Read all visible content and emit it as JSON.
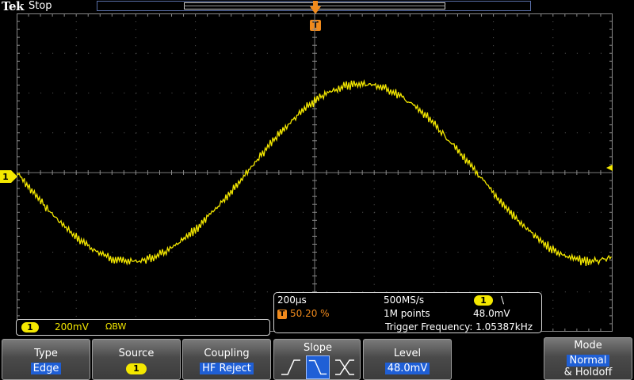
{
  "header": {
    "brand": "Tek",
    "status": "Stop"
  },
  "colors": {
    "trace": "#f4e800",
    "trigger_marker": "#f08a1c",
    "grid": "#5a5a5a",
    "selected": "#1f5fd6"
  },
  "trigger_marker_label": "T",
  "channel_marker_label": "1",
  "channel_info": {
    "channel": "1",
    "scale": "200mV",
    "bw_symbol": "ΩBW"
  },
  "readout": {
    "timebase": "200µs",
    "trigger_position": "50.20 %",
    "sample_rate": "500MS/s",
    "record_length": "1M points",
    "trigger_channel": "1",
    "trigger_slope_symbol": "\\",
    "trigger_level": "48.0mV",
    "trigger_frequency": "Trigger Frequency: 1.05387kHz"
  },
  "menu": {
    "type": {
      "title": "Type",
      "value": "Edge"
    },
    "source": {
      "title": "Source",
      "value": "1"
    },
    "coupling": {
      "title": "Coupling",
      "value": "HF Reject"
    },
    "slope": {
      "title": "Slope",
      "selected": "falling",
      "options": [
        "rising",
        "falling",
        "either"
      ]
    },
    "level": {
      "title": "Level",
      "value": "48.0mV"
    },
    "mode": {
      "title": "Mode",
      "value": "Normal",
      "subtitle": "& Holdoff"
    }
  },
  "icons": [
    "trigger-position-arrow-icon",
    "trigger-t-icon",
    "channel-ground-marker-icon",
    "rising-edge-icon",
    "falling-edge-icon",
    "either-edge-icon",
    "trigger-level-arrow-icon"
  ]
}
